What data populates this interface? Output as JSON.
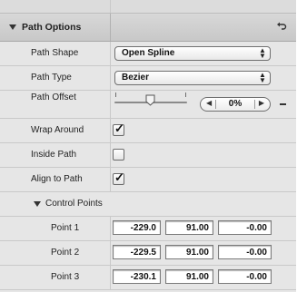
{
  "header": {
    "title": "Path Options",
    "reset_icon": "reset-arrow-icon"
  },
  "rows": {
    "path_shape": {
      "label": "Path Shape",
      "value": "Open Spline"
    },
    "path_type": {
      "label": "Path Type",
      "value": "Bezier"
    },
    "path_offset": {
      "label": "Path Offset",
      "value": "0%",
      "slider_fraction": 0.0
    },
    "wrap_around": {
      "label": "Wrap Around",
      "checked": true
    },
    "inside_path": {
      "label": "Inside Path",
      "checked": false
    },
    "align_to_path": {
      "label": "Align to Path",
      "checked": true
    }
  },
  "control_points": {
    "label": "Control Points",
    "points": [
      {
        "label": "Point 1",
        "x": "-229.0",
        "y": "91.00",
        "z": "-0.00"
      },
      {
        "label": "Point 2",
        "x": "-229.5",
        "y": "91.00",
        "z": "-0.00"
      },
      {
        "label": "Point 3",
        "x": "-230.1",
        "y": "91.00",
        "z": "-0.00"
      }
    ]
  },
  "glyphs": {
    "check": "✓",
    "popup_arrows": "▲▼",
    "step_dec": "◀",
    "step_inc": "▶"
  }
}
